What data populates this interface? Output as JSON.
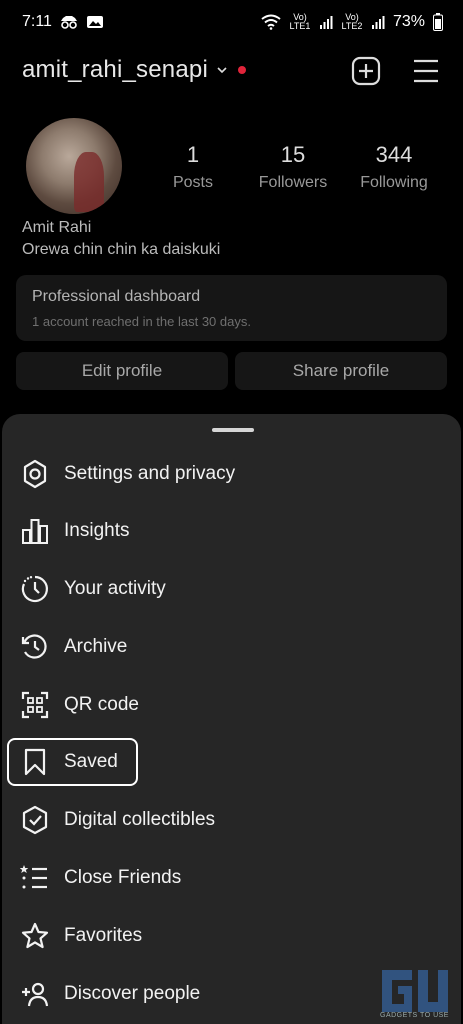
{
  "status_bar": {
    "time": "7:11",
    "net1": "Vo) LTE1",
    "net2": "Vo) LTE2",
    "battery": "73%"
  },
  "header": {
    "username": "amit_rahi_senapi"
  },
  "profile": {
    "stats": [
      {
        "value": "1",
        "label": "Posts"
      },
      {
        "value": "15",
        "label": "Followers"
      },
      {
        "value": "344",
        "label": "Following"
      }
    ],
    "name": "Amit Rahi",
    "bio": "Orewa chin chin ka daiskuki"
  },
  "dashboard": {
    "title": "Professional dashboard",
    "subtitle": "1 account reached in the last 30 days."
  },
  "buttons": {
    "edit": "Edit profile",
    "share": "Share profile"
  },
  "menu": [
    {
      "label": "Settings and privacy",
      "icon": "settings-icon"
    },
    {
      "label": "Insights",
      "icon": "insights-icon"
    },
    {
      "label": "Your activity",
      "icon": "activity-icon"
    },
    {
      "label": "Archive",
      "icon": "archive-icon"
    },
    {
      "label": "QR code",
      "icon": "qr-code-icon"
    },
    {
      "label": "Saved",
      "icon": "bookmark-icon"
    },
    {
      "label": "Digital collectibles",
      "icon": "shield-check-icon"
    },
    {
      "label": "Close Friends",
      "icon": "close-friends-icon"
    },
    {
      "label": "Favorites",
      "icon": "star-icon"
    },
    {
      "label": "Discover people",
      "icon": "add-person-icon"
    }
  ],
  "watermark": {
    "text": "GADGETS TO USE"
  }
}
